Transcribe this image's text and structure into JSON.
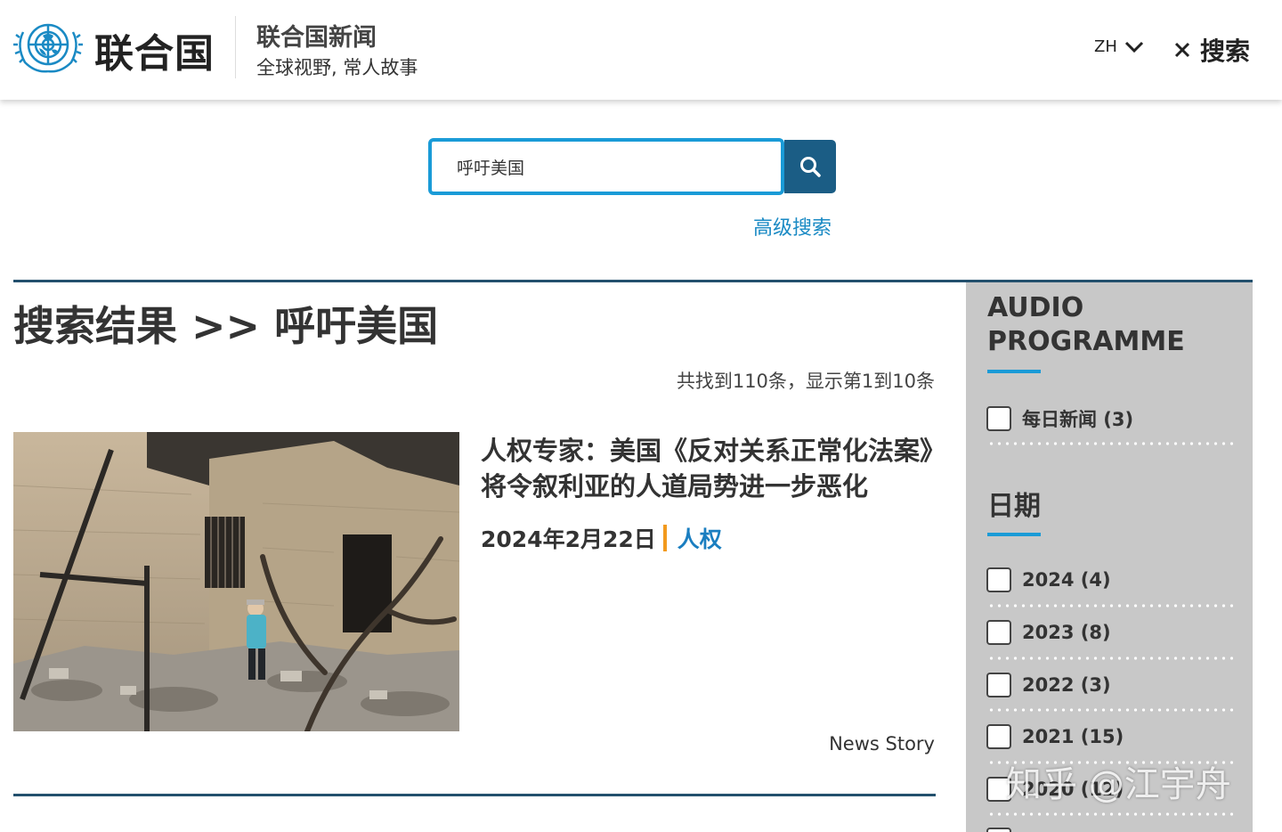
{
  "header": {
    "org_name": "联合国",
    "site_title": "联合国新闻",
    "site_tagline": "全球视野, 常人故事",
    "language": "ZH",
    "search_toggle_label": "搜索"
  },
  "search": {
    "query": "呼吁美国",
    "advanced_label": "高级搜索"
  },
  "results": {
    "heading": "搜索结果 >> 呼吁美国",
    "count_text": "共找到110条，显示第1到10条",
    "items": [
      {
        "title": "人权专家：美国《反对关系正常化法案》将令叙利亚的人道局势进一步恶化",
        "date": "2024年2月22日",
        "category": "人权",
        "type": "News Story"
      }
    ]
  },
  "sidebar": {
    "audio_heading": "AUDIO PROGRAMME",
    "audio_facets": [
      {
        "label": "每日新闻 (3)"
      }
    ],
    "date_heading": "日期",
    "date_facets": [
      {
        "label": "2024 (4)"
      },
      {
        "label": "2023 (8)"
      },
      {
        "label": "2022 (3)"
      },
      {
        "label": "2021 (15)"
      },
      {
        "label": "2020 (12)"
      }
    ]
  },
  "watermark": "知乎 @江宇舟",
  "colors": {
    "accent_blue": "#1a9bd7",
    "button_navy": "#1b5d85",
    "rule_navy": "#23506d",
    "separator_orange": "#f29a1d",
    "link_blue": "#1a7ec0",
    "sidebar_bg": "#c8c8c8"
  }
}
